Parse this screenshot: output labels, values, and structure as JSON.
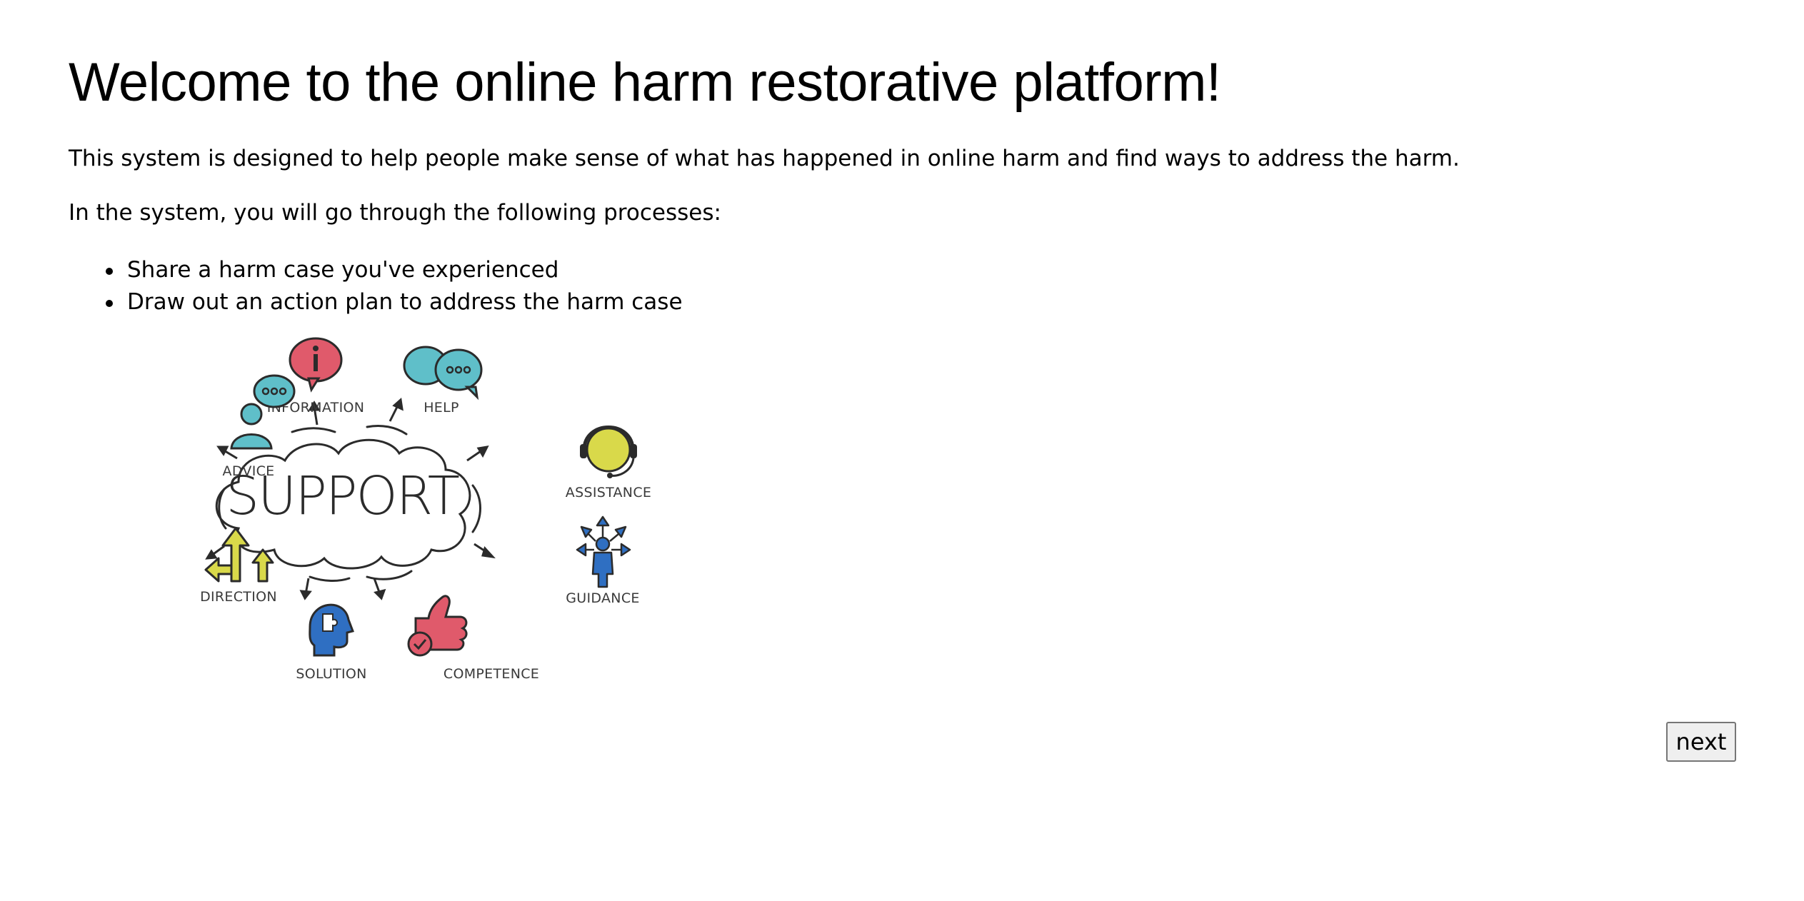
{
  "header": {
    "title": "Welcome to the online harm restorative platform!"
  },
  "intro": {
    "paragraph": "This system is designed to help people make sense of what has happened in online harm and find ways to address the harm.",
    "process_lead": "In the system, you will go through the following processes:",
    "steps": [
      "Share a harm case you've experienced",
      "Draw out an action plan to address the harm case"
    ]
  },
  "illustration": {
    "center": "SUPPORT",
    "labels": {
      "information": "INFORMATION",
      "help": "HELP",
      "advice": "ADVICE",
      "assistance": "ASSISTANCE",
      "direction": "DIRECTION",
      "guidance": "GUIDANCE",
      "solution": "SOLUTION",
      "competence": "COMPETENCE"
    },
    "colors": {
      "red": "#e05a6b",
      "teal": "#5fbfc9",
      "yellow": "#d9d94a",
      "blue": "#2f6fc2",
      "ink": "#2b2b2b"
    }
  },
  "actions": {
    "next_label": "next"
  }
}
